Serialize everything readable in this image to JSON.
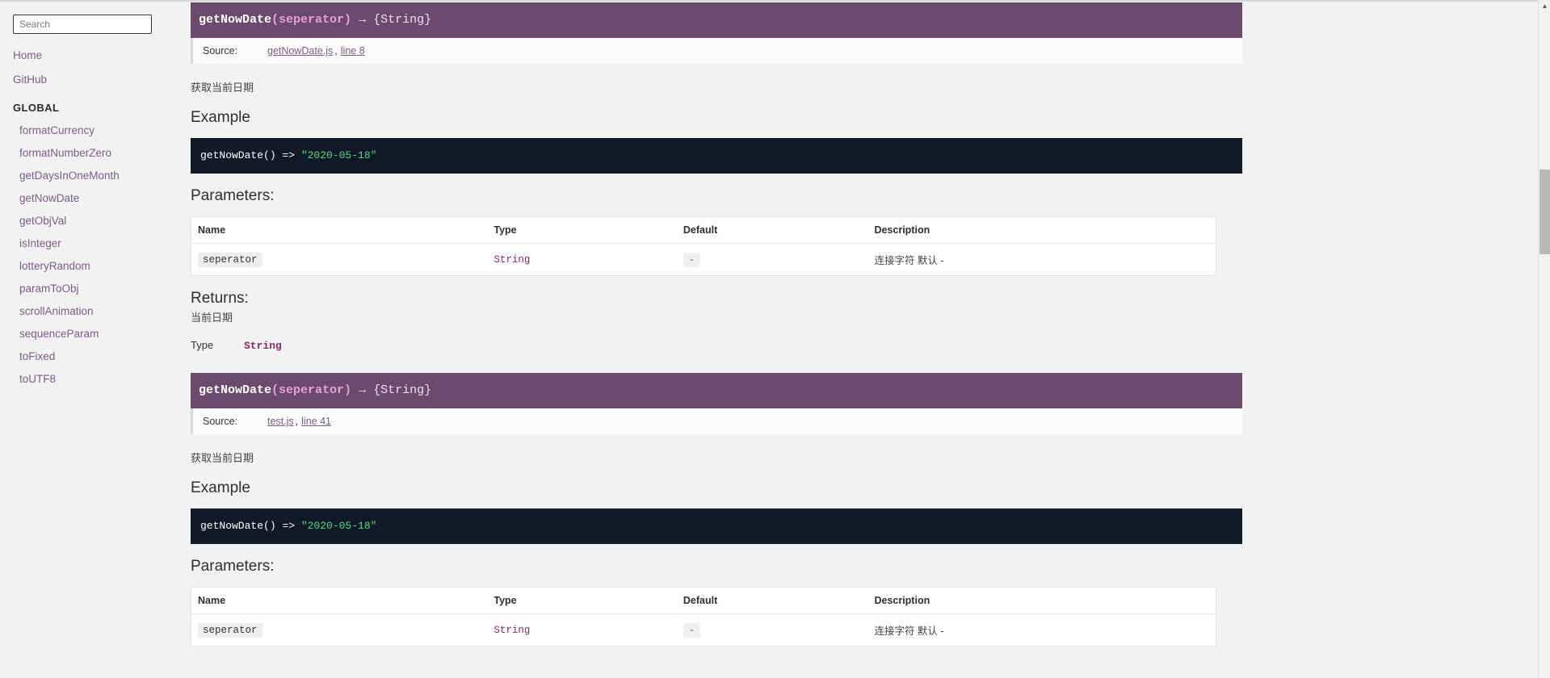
{
  "sidebar": {
    "search": {
      "placeholder": "Search",
      "value": ""
    },
    "links": [
      {
        "label": "Home"
      },
      {
        "label": "GitHub"
      }
    ],
    "section_title": "GLOBAL",
    "items": [
      {
        "label": "formatCurrency"
      },
      {
        "label": "formatNumberZero"
      },
      {
        "label": "getDaysInOneMonth"
      },
      {
        "label": "getNowDate"
      },
      {
        "label": "getObjVal"
      },
      {
        "label": "isInteger"
      },
      {
        "label": "lotteryRandom"
      },
      {
        "label": "paramToObj"
      },
      {
        "label": "scrollAnimation"
      },
      {
        "label": "sequenceParam"
      },
      {
        "label": "toFixed"
      },
      {
        "label": "toUTF8"
      }
    ]
  },
  "colors": {
    "header_purple": "#6c4a6d",
    "param_pink": "#e79fd8",
    "link_purple": "#7b5c84",
    "code_bg": "#111827",
    "code_string_green": "#4ade80",
    "type_magenta": "#8b2a6b"
  },
  "sections": [
    {
      "signature": {
        "name": "getNowDate",
        "params": "(seperator)",
        "arrow": "→",
        "returns": "{String}"
      },
      "source": {
        "label": "Source:",
        "file": "getNowDate.js",
        "separator": ",",
        "line": "line 8"
      },
      "description": "获取当前日期",
      "example_heading": "Example",
      "example_code_prefix": "getNowDate() => ",
      "example_code_string": "\"2020-05-18\"",
      "parameters_heading": "Parameters:",
      "table": {
        "headers": [
          "Name",
          "Type",
          "Default",
          "Description"
        ],
        "rows": [
          {
            "name": "seperator",
            "type": "String",
            "default": "-",
            "description": "连接字符 默认  -"
          }
        ]
      },
      "returns_heading": "Returns:",
      "returns_description": "当前日期",
      "type_label": "Type",
      "type_value": "String"
    },
    {
      "signature": {
        "name": "getNowDate",
        "params": "(seperator)",
        "arrow": "→",
        "returns": "{String}"
      },
      "source": {
        "label": "Source:",
        "file": "test.js",
        "separator": ",",
        "line": "line 41"
      },
      "description": "获取当前日期",
      "example_heading": "Example",
      "example_code_prefix": "getNowDate() => ",
      "example_code_string": "\"2020-05-18\"",
      "parameters_heading": "Parameters:",
      "table": {
        "headers": [
          "Name",
          "Type",
          "Default",
          "Description"
        ],
        "rows": [
          {
            "name": "seperator",
            "type": "String",
            "default": "-",
            "description": "连接字符 默认  -"
          }
        ]
      }
    }
  ],
  "scrollbar": {
    "up_arrow": "▲"
  }
}
